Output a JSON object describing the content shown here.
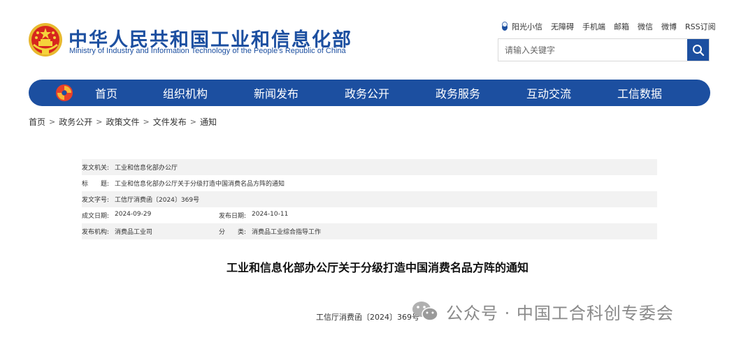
{
  "header": {
    "site_name_cn": "中华人民共和国工业和信息化部",
    "site_name_en": "Ministry of Industry and Information Technology of the People's Republic of China",
    "emblem_icon": "national-emblem-icon",
    "top_links": [
      "阳光小信",
      "无障碍",
      "手机端",
      "邮箱",
      "微信",
      "微博",
      "RSS订阅"
    ],
    "search": {
      "placeholder": "请输入关键字",
      "value": ""
    }
  },
  "nav": {
    "items": [
      "首页",
      "组织机构",
      "新闻发布",
      "政务公开",
      "政务服务",
      "互动交流",
      "工信数据"
    ]
  },
  "breadcrumb": [
    "首页",
    "政务公开",
    "政策文件",
    "文件发布",
    "通知"
  ],
  "meta": {
    "issuer": {
      "label": "发文机关:",
      "value": "工业和信息化部办公厅"
    },
    "title": {
      "label": "标　　题:",
      "value": "工业和信息化部办公厅关于分级打造中国消费名品方阵的通知"
    },
    "doc_no": {
      "label": "发文字号:",
      "value": "工信厅消费函〔2024〕369号"
    },
    "created": {
      "label": "成文日期:",
      "value": "2024-09-29"
    },
    "published": {
      "label": "发布日期:",
      "value": "2024-10-11"
    },
    "publisher": {
      "label": "发布机构:",
      "value": "消费品工业司"
    },
    "category": {
      "label": "分　　类:",
      "value": "消费品工业综合指导工作"
    }
  },
  "content": {
    "title": "工业和信息化部办公厅关于分级打造中国消费名品方阵的通知",
    "doc_number": "工信厅消费函〔2024〕369号"
  },
  "watermark": {
    "text": "公众号 · 中国工合科创专委会"
  },
  "colors": {
    "brand_blue": "#1c4fa0",
    "row_gray": "#f2f2f2"
  }
}
